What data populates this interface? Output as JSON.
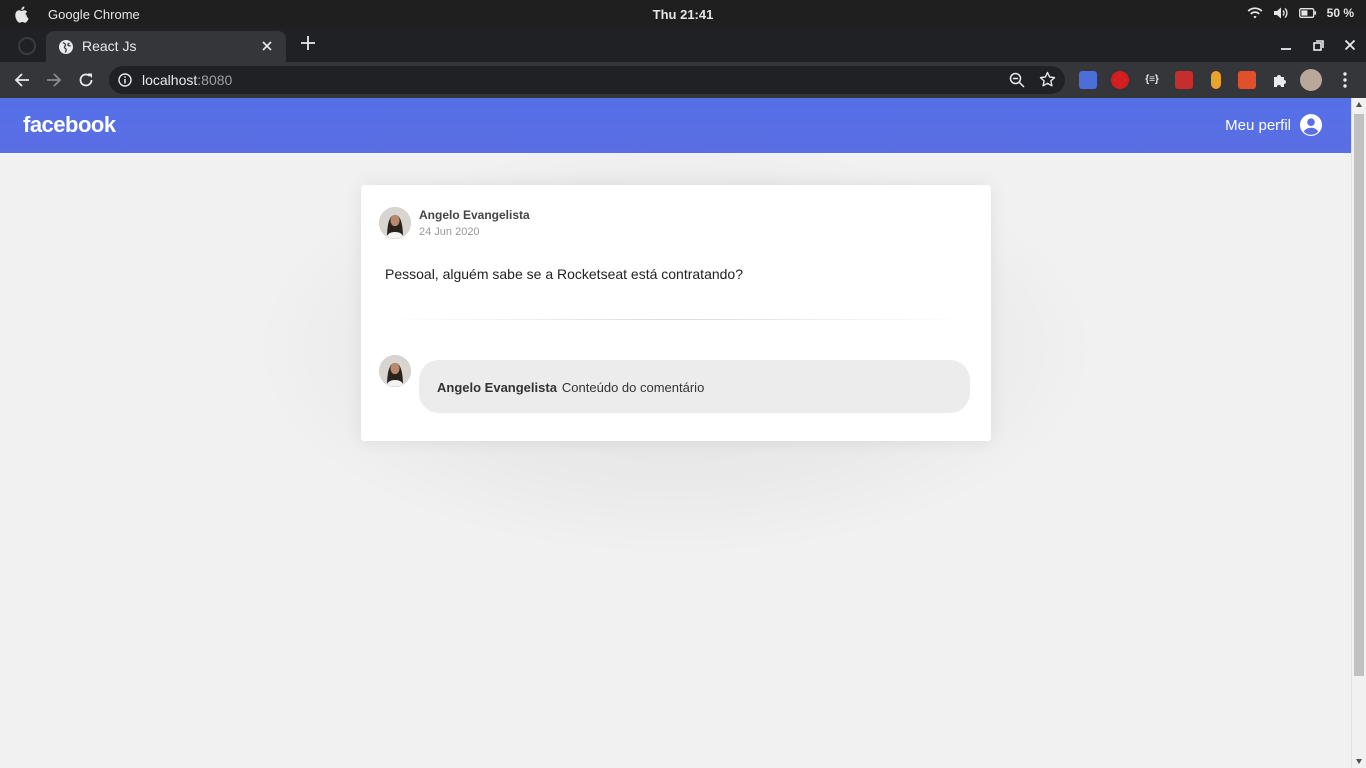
{
  "os": {
    "app_name": "Google Chrome",
    "clock": "Thu 21:41",
    "battery": "50 %"
  },
  "browser": {
    "tab_title": "React Js",
    "url_host": "localhost",
    "url_port": ":8080",
    "icons": [
      "apple-icon",
      "wifi-icon",
      "volume-icon",
      "battery-icon",
      "globe-icon",
      "close-icon",
      "plus-icon",
      "minimize-icon",
      "restore-icon",
      "back-icon",
      "forward-icon",
      "reload-icon",
      "info-icon",
      "zoom-icon",
      "star-icon",
      "puzzle-icon",
      "kebab-icon"
    ]
  },
  "header": {
    "logo": "facebook",
    "profile_label": "Meu perfil"
  },
  "post": {
    "author": "Angelo Evangelista",
    "date": "24 Jun 2020",
    "content": "Pessoal, alguém sabe se a Rocketseat está contratando?",
    "comments": [
      {
        "author": "Angelo Evangelista",
        "content": "Conteúdo do comentário"
      }
    ]
  },
  "colors": {
    "header": "#5b6ee3",
    "page_bg": "#f1f1f1",
    "bubble": "#ececec"
  }
}
